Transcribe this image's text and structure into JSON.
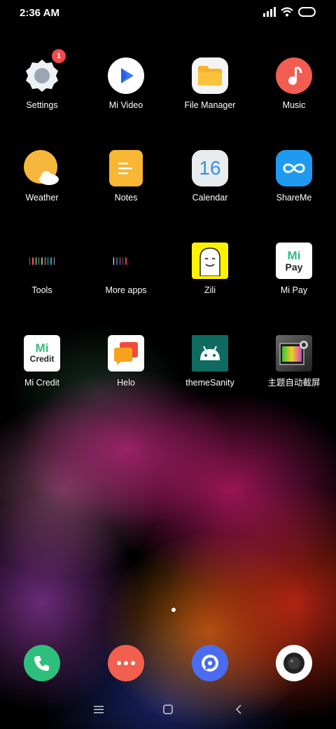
{
  "status": {
    "time": "2:36 AM"
  },
  "apps": [
    {
      "label": "Settings",
      "badge": "1"
    },
    {
      "label": "Mi Video"
    },
    {
      "label": "File Manager"
    },
    {
      "label": "Music"
    },
    {
      "label": "Weather"
    },
    {
      "label": "Notes"
    },
    {
      "label": "Calendar",
      "icon_text": "16"
    },
    {
      "label": "ShareMe"
    },
    {
      "label": "Tools"
    },
    {
      "label": "More apps"
    },
    {
      "label": "Zili"
    },
    {
      "label": "Mi Pay",
      "icon_text_top": "Mi",
      "icon_text_bottom": "Pay"
    },
    {
      "label": "Mi Credit",
      "icon_text_top": "Mi",
      "icon_text_bottom": "Credit"
    },
    {
      "label": "Helo"
    },
    {
      "label": "themeSanity"
    },
    {
      "label": "主题自动截屏"
    }
  ],
  "dock": [
    "phone-icon",
    "messages-icon",
    "browser-icon",
    "camera-icon"
  ],
  "colors": {
    "badge": "#f04a4a",
    "phone": "#2fbf7d",
    "messages": "#f25f4f",
    "browser": "#4a6cf0",
    "music": "#f25d52"
  }
}
